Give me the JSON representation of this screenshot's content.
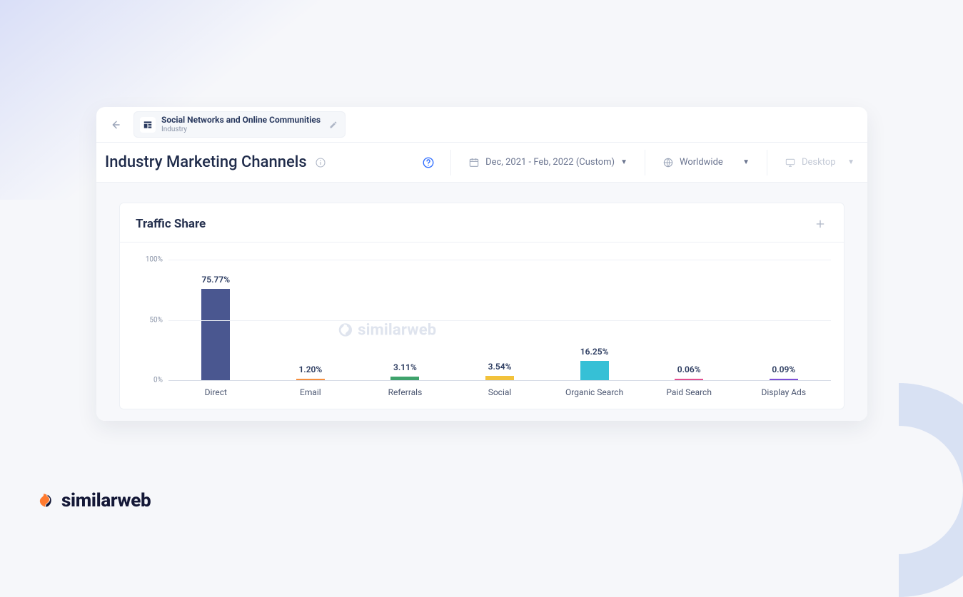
{
  "topbar": {
    "context_title": "Social Networks and Online Communities",
    "context_subtitle": "Industry"
  },
  "page": {
    "title": "Industry Marketing Channels"
  },
  "filters": {
    "date_range": "Dec, 2021 - Feb, 2022 (Custom)",
    "region": "Worldwide",
    "device": "Desktop"
  },
  "chart": {
    "title": "Traffic Share",
    "watermark": "similarweb"
  },
  "footer": {
    "brand": "similarweb"
  },
  "chart_data": {
    "type": "bar",
    "title": "Traffic Share",
    "ylabel": "",
    "xlabel": "",
    "ylim": [
      0,
      100
    ],
    "yticks": [
      0,
      50,
      100
    ],
    "ytick_labels": [
      "0%",
      "50%",
      "100%"
    ],
    "categories": [
      "Direct",
      "Email",
      "Referrals",
      "Social",
      "Organic Search",
      "Paid Search",
      "Display Ads"
    ],
    "values": [
      75.77,
      1.2,
      3.11,
      3.54,
      16.25,
      0.06,
      0.09
    ],
    "value_labels": [
      "75.77%",
      "1.20%",
      "3.11%",
      "3.54%",
      "16.25%",
      "0.06%",
      "0.09%"
    ],
    "series_colors": [
      "#4a5790",
      "#f58f3f",
      "#3fa36c",
      "#f2c23b",
      "#36c0d6",
      "#e24e8f",
      "#7d4fd6"
    ]
  }
}
